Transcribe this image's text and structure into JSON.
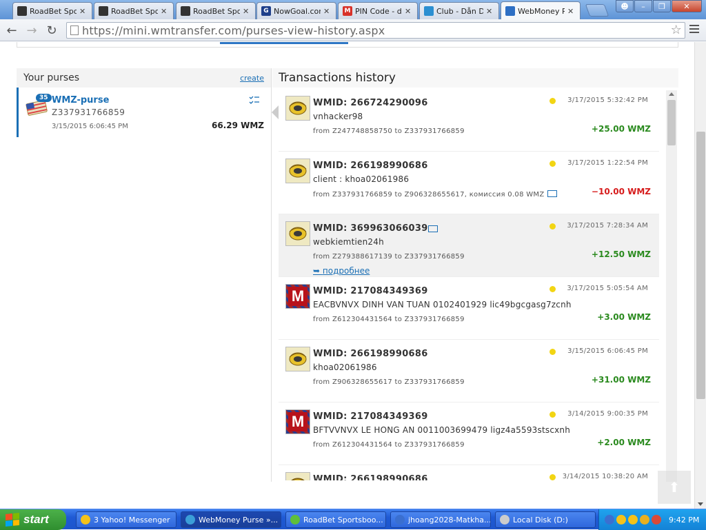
{
  "tabs": [
    {
      "title": "RoadBet Spor",
      "icon_color": "#333333"
    },
    {
      "title": "RoadBet Spor",
      "icon_color": "#333333"
    },
    {
      "title": "RoadBet Spor",
      "icon_color": "#333333"
    },
    {
      "title": "NowGoal.com",
      "icon_color": "#1e3f8a",
      "icon_letter": "G"
    },
    {
      "title": "PIN Code - dc",
      "icon_color": "#d8322a",
      "icon_letter": "M"
    },
    {
      "title": "Club - Dẫn Dắ",
      "icon_color": "#2b8fd1"
    },
    {
      "title": "WebMoney Pu",
      "icon_color": "#2e6fc4"
    }
  ],
  "toolbar": {
    "url": "https://mini.wmtransfer.com/purses-view-history.aspx"
  },
  "purses": {
    "title": "Your purses",
    "create_label": "create",
    "items": [
      {
        "badge": "35",
        "name": "WMZ-purse",
        "number": "Z337931766859",
        "date": "3/15/2015 6:06:45 PM",
        "balance": "66.29 WMZ"
      }
    ]
  },
  "history": {
    "title": "Transactions history",
    "more_label": "подробнее",
    "items": [
      {
        "avatar": "wm",
        "wmid": "WMID: 266724290096",
        "desc": "vnhacker98",
        "route": "from Z247748858750 to Z337931766859",
        "time": "3/17/2015 5:32:42 PM",
        "amount": "+25.00 WMZ",
        "sign": "pos"
      },
      {
        "avatar": "wm",
        "wmid": "WMID: 266198990686",
        "desc": "client : khoa02061986",
        "route": "from Z337931766859 to Z906328655617, комиссия 0.08 WMZ",
        "time": "3/17/2015 1:22:54 PM",
        "amount": "−10.00 WMZ",
        "sign": "neg"
      },
      {
        "avatar": "wm",
        "wmid": "WMID: 369963066039",
        "desc": "webkiemtien24h",
        "route": "from Z279388617139 to Z337931766859",
        "time": "3/17/2015 7:28:34 AM",
        "amount": "+12.50 WMZ",
        "sign": "pos"
      },
      {
        "avatar": "m",
        "avatar_letter": "M",
        "wmid": "WMID: 217084349369",
        "desc": "EACBVNVX DINH VAN TUAN 0102401929 lic49bgcgasg7zcnh",
        "route": "from Z612304431564 to Z337931766859",
        "time": "3/17/2015 5:05:54 AM",
        "amount": "+3.00 WMZ",
        "sign": "pos"
      },
      {
        "avatar": "wm",
        "wmid": "WMID: 266198990686",
        "desc": "khoa02061986",
        "route": "from Z906328655617 to Z337931766859",
        "time": "3/15/2015 6:06:45 PM",
        "amount": "+31.00 WMZ",
        "sign": "pos"
      },
      {
        "avatar": "m",
        "avatar_letter": "M",
        "wmid": "WMID: 217084349369",
        "desc": "BFTVVNVX LE HONG AN 0011003699479 ligz4a5593stscxnh",
        "route": "from Z612304431564 to Z337931766859",
        "time": "3/14/2015 9:00:35 PM",
        "amount": "+2.00 WMZ",
        "sign": "pos"
      },
      {
        "avatar": "wm",
        "wmid": "WMID: 266198990686",
        "desc": "",
        "route": "",
        "time": "3/14/2015 10:38:20 AM",
        "amount": "",
        "sign": "pos"
      }
    ]
  },
  "taskbar": {
    "start_label": "start",
    "tasks": [
      {
        "label": "3 Yahoo! Messenger",
        "icon_color": "#f4c21a"
      },
      {
        "label": "WebMoney Purse »...",
        "icon_color": "#3b9ed8"
      },
      {
        "label": "RoadBet Sportsboo...",
        "icon_color": "#5fbf3a"
      },
      {
        "label": "jhoang2028-Matkha...",
        "icon_color": "#3a6fd0"
      },
      {
        "label": "Local Disk (D:)",
        "icon_color": "#cccccc"
      }
    ],
    "clock": "9:42 PM"
  }
}
